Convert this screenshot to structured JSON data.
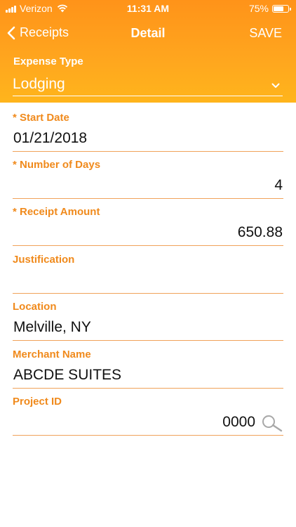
{
  "status_bar": {
    "carrier": "Verizon",
    "time": "11:31 AM",
    "battery": "75%",
    "battery_level": 0.75
  },
  "nav": {
    "back_label": "Receipts",
    "title": "Detail",
    "save_label": "SAVE"
  },
  "expense_type": {
    "label": "Expense Type",
    "value": "Lodging"
  },
  "fields": {
    "start_date": {
      "label": "* Start Date",
      "value": "01/21/2018"
    },
    "number_of_days": {
      "label": "* Number of Days",
      "value": "4"
    },
    "receipt_amount": {
      "label": "* Receipt Amount",
      "value": "650.88"
    },
    "justification": {
      "label": "Justification",
      "value": ""
    },
    "location": {
      "label": "Location",
      "value": "Melville, NY"
    },
    "merchant_name": {
      "label": "Merchant Name",
      "value": "ABCDE SUITES"
    },
    "project_id": {
      "label": "Project ID",
      "value": "0000"
    }
  },
  "icons": {
    "back": "chevron-left-icon",
    "dropdown": "chevron-down-icon",
    "search": "search-icon",
    "wifi": "wifi-icon",
    "signal": "signal-icon",
    "battery": "battery-icon"
  },
  "colors": {
    "accent": "#f08a1c",
    "header_top": "#ff9319",
    "header_bottom": "#ffb51c"
  }
}
